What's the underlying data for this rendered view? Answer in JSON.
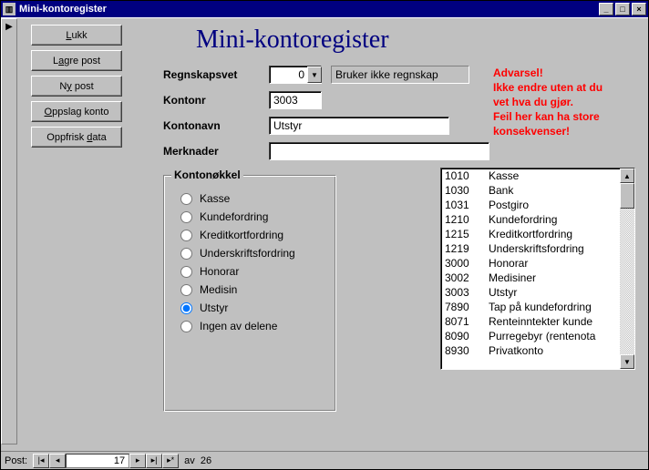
{
  "window": {
    "title": "Mini-kontoregister"
  },
  "heading": "Mini-kontoregister",
  "buttons": {
    "lukk": "Lukk",
    "lagre": "Lagre post",
    "ny": "Ny post",
    "oppslag": "Oppslag konto",
    "oppfrisk": "Oppfrisk data"
  },
  "labels": {
    "regnskapsvet": "Regnskapsvet",
    "kontonr": "Kontonr",
    "kontonavn": "Kontonavn",
    "merknader": "Merknader",
    "kontonokkel": "Kontonøkkel"
  },
  "fields": {
    "regnskapsvet_value": "0",
    "regnskapsvet_desc": "Bruker ikke regnskap",
    "kontonr": "3003",
    "kontonavn": "Utstyr",
    "merknader": ""
  },
  "warning": {
    "l1": "Advarsel!",
    "l2": "Ikke endre uten at du",
    "l3": "vet hva du gjør.",
    "l4": "Feil her kan ha store",
    "l5": "konsekvenser!"
  },
  "radios": [
    {
      "label": "Kasse",
      "checked": false
    },
    {
      "label": "Kundefordring",
      "checked": false
    },
    {
      "label": "Kreditkortfordring",
      "checked": false
    },
    {
      "label": "Underskriftsfordring",
      "checked": false
    },
    {
      "label": "Honorar",
      "checked": false
    },
    {
      "label": "Medisin",
      "checked": false
    },
    {
      "label": "Utstyr",
      "checked": true
    },
    {
      "label": "Ingen av delene",
      "checked": false
    }
  ],
  "list": [
    {
      "nr": "1010",
      "navn": "Kasse"
    },
    {
      "nr": "1030",
      "navn": "Bank"
    },
    {
      "nr": "1031",
      "navn": "Postgiro"
    },
    {
      "nr": "1210",
      "navn": "Kundefordring"
    },
    {
      "nr": "1215",
      "navn": "Kreditkortfordring"
    },
    {
      "nr": "1219",
      "navn": "Underskriftsfordring"
    },
    {
      "nr": "3000",
      "navn": "Honorar"
    },
    {
      "nr": "3002",
      "navn": "Medisiner"
    },
    {
      "nr": "3003",
      "navn": "Utstyr"
    },
    {
      "nr": "7890",
      "navn": "Tap på kundefordring"
    },
    {
      "nr": "8071",
      "navn": "Renteinntekter kunde"
    },
    {
      "nr": "8090",
      "navn": "Purregebyr (rentenota"
    },
    {
      "nr": "8930",
      "navn": "Privatkonto"
    }
  ],
  "nav": {
    "label": "Post:",
    "current": "17",
    "of_label": "av",
    "total": "26"
  }
}
